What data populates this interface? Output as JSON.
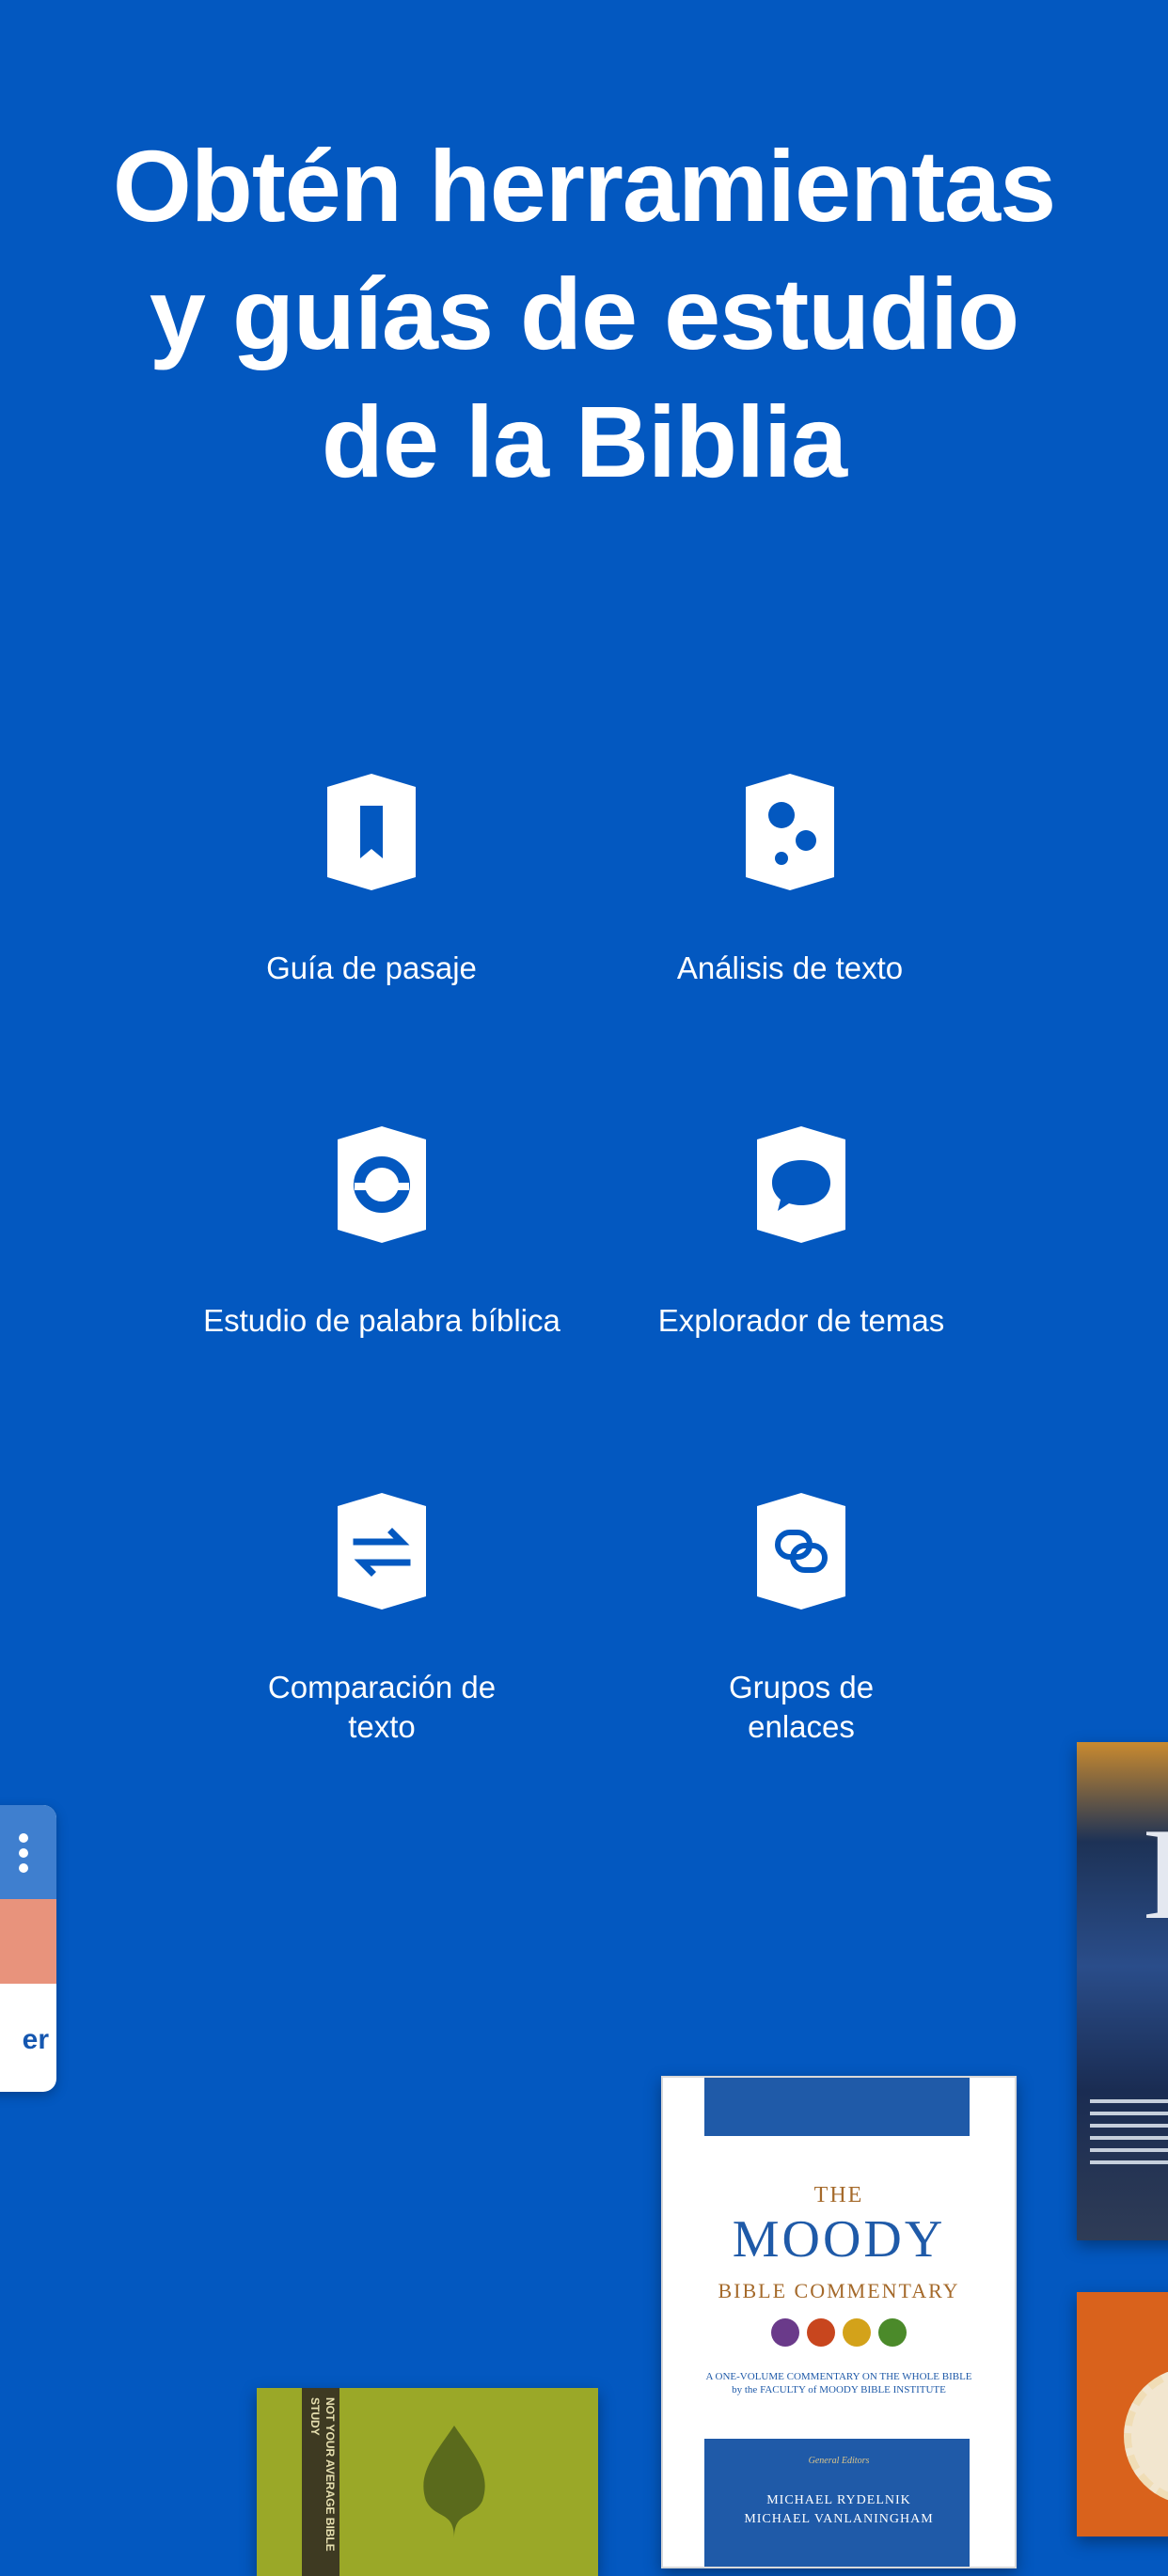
{
  "headline": {
    "line1": "Obtén herramientas",
    "line2": "y guías de estudio",
    "line3": "de la Biblia"
  },
  "features": [
    {
      "label": "Guía de pasaje",
      "icon": "bookmark-icon"
    },
    {
      "label": "Análisis de texto",
      "icon": "dots-analysis-icon"
    },
    {
      "label": "Estudio de palabra bíblica",
      "icon": "ring-study-icon"
    },
    {
      "label": "Explorador de temas",
      "icon": "speech-bubble-icon"
    },
    {
      "label": "Comparación de texto",
      "icon": "swap-arrows-icon"
    },
    {
      "label": "Grupos de enlaces",
      "icon": "link-icon"
    }
  ],
  "feature_labels_wrapped": {
    "comparacion_line1": "Comparación de",
    "comparacion_line2": "texto",
    "grupos_line1": "Grupos de",
    "grupos_line2": "enlaces"
  },
  "preview_card": {
    "button_fragment": "er"
  },
  "books": {
    "moody": {
      "the": "THE",
      "title": "MOODY",
      "subtitle": "BIBLE COMMENTARY",
      "tagline1": "A ONE-VOLUME COMMENTARY ON THE WHOLE BIBLE",
      "tagline2": "by the FACULTY of MOODY BIBLE INSTITUTE",
      "editors_label": "General Editors",
      "editor1": "MICHAEL RYDELNIK",
      "editor2": "MICHAEL VANLANINGHAM"
    },
    "green": {
      "spine_text": "NOT YOUR AVERAGE BIBLE STUDY"
    }
  },
  "colors": {
    "background": "#0358c0",
    "icon_fill": "#ffffff"
  }
}
